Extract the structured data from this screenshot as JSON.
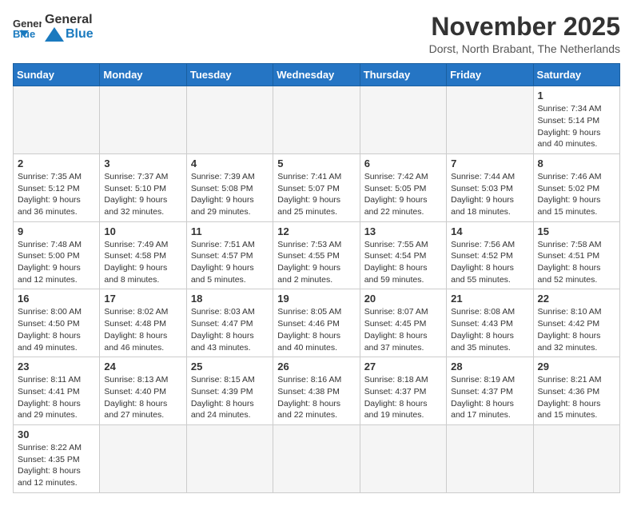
{
  "header": {
    "logo_general": "General",
    "logo_blue": "Blue",
    "month_title": "November 2025",
    "subtitle": "Dorst, North Brabant, The Netherlands"
  },
  "weekdays": [
    "Sunday",
    "Monday",
    "Tuesday",
    "Wednesday",
    "Thursday",
    "Friday",
    "Saturday"
  ],
  "weeks": [
    [
      {
        "day": "",
        "info": ""
      },
      {
        "day": "",
        "info": ""
      },
      {
        "day": "",
        "info": ""
      },
      {
        "day": "",
        "info": ""
      },
      {
        "day": "",
        "info": ""
      },
      {
        "day": "",
        "info": ""
      },
      {
        "day": "1",
        "info": "Sunrise: 7:34 AM\nSunset: 5:14 PM\nDaylight: 9 hours and 40 minutes."
      }
    ],
    [
      {
        "day": "2",
        "info": "Sunrise: 7:35 AM\nSunset: 5:12 PM\nDaylight: 9 hours and 36 minutes."
      },
      {
        "day": "3",
        "info": "Sunrise: 7:37 AM\nSunset: 5:10 PM\nDaylight: 9 hours and 32 minutes."
      },
      {
        "day": "4",
        "info": "Sunrise: 7:39 AM\nSunset: 5:08 PM\nDaylight: 9 hours and 29 minutes."
      },
      {
        "day": "5",
        "info": "Sunrise: 7:41 AM\nSunset: 5:07 PM\nDaylight: 9 hours and 25 minutes."
      },
      {
        "day": "6",
        "info": "Sunrise: 7:42 AM\nSunset: 5:05 PM\nDaylight: 9 hours and 22 minutes."
      },
      {
        "day": "7",
        "info": "Sunrise: 7:44 AM\nSunset: 5:03 PM\nDaylight: 9 hours and 18 minutes."
      },
      {
        "day": "8",
        "info": "Sunrise: 7:46 AM\nSunset: 5:02 PM\nDaylight: 9 hours and 15 minutes."
      }
    ],
    [
      {
        "day": "9",
        "info": "Sunrise: 7:48 AM\nSunset: 5:00 PM\nDaylight: 9 hours and 12 minutes."
      },
      {
        "day": "10",
        "info": "Sunrise: 7:49 AM\nSunset: 4:58 PM\nDaylight: 9 hours and 8 minutes."
      },
      {
        "day": "11",
        "info": "Sunrise: 7:51 AM\nSunset: 4:57 PM\nDaylight: 9 hours and 5 minutes."
      },
      {
        "day": "12",
        "info": "Sunrise: 7:53 AM\nSunset: 4:55 PM\nDaylight: 9 hours and 2 minutes."
      },
      {
        "day": "13",
        "info": "Sunrise: 7:55 AM\nSunset: 4:54 PM\nDaylight: 8 hours and 59 minutes."
      },
      {
        "day": "14",
        "info": "Sunrise: 7:56 AM\nSunset: 4:52 PM\nDaylight: 8 hours and 55 minutes."
      },
      {
        "day": "15",
        "info": "Sunrise: 7:58 AM\nSunset: 4:51 PM\nDaylight: 8 hours and 52 minutes."
      }
    ],
    [
      {
        "day": "16",
        "info": "Sunrise: 8:00 AM\nSunset: 4:50 PM\nDaylight: 8 hours and 49 minutes."
      },
      {
        "day": "17",
        "info": "Sunrise: 8:02 AM\nSunset: 4:48 PM\nDaylight: 8 hours and 46 minutes."
      },
      {
        "day": "18",
        "info": "Sunrise: 8:03 AM\nSunset: 4:47 PM\nDaylight: 8 hours and 43 minutes."
      },
      {
        "day": "19",
        "info": "Sunrise: 8:05 AM\nSunset: 4:46 PM\nDaylight: 8 hours and 40 minutes."
      },
      {
        "day": "20",
        "info": "Sunrise: 8:07 AM\nSunset: 4:45 PM\nDaylight: 8 hours and 37 minutes."
      },
      {
        "day": "21",
        "info": "Sunrise: 8:08 AM\nSunset: 4:43 PM\nDaylight: 8 hours and 35 minutes."
      },
      {
        "day": "22",
        "info": "Sunrise: 8:10 AM\nSunset: 4:42 PM\nDaylight: 8 hours and 32 minutes."
      }
    ],
    [
      {
        "day": "23",
        "info": "Sunrise: 8:11 AM\nSunset: 4:41 PM\nDaylight: 8 hours and 29 minutes."
      },
      {
        "day": "24",
        "info": "Sunrise: 8:13 AM\nSunset: 4:40 PM\nDaylight: 8 hours and 27 minutes."
      },
      {
        "day": "25",
        "info": "Sunrise: 8:15 AM\nSunset: 4:39 PM\nDaylight: 8 hours and 24 minutes."
      },
      {
        "day": "26",
        "info": "Sunrise: 8:16 AM\nSunset: 4:38 PM\nDaylight: 8 hours and 22 minutes."
      },
      {
        "day": "27",
        "info": "Sunrise: 8:18 AM\nSunset: 4:37 PM\nDaylight: 8 hours and 19 minutes."
      },
      {
        "day": "28",
        "info": "Sunrise: 8:19 AM\nSunset: 4:37 PM\nDaylight: 8 hours and 17 minutes."
      },
      {
        "day": "29",
        "info": "Sunrise: 8:21 AM\nSunset: 4:36 PM\nDaylight: 8 hours and 15 minutes."
      }
    ],
    [
      {
        "day": "30",
        "info": "Sunrise: 8:22 AM\nSunset: 4:35 PM\nDaylight: 8 hours and 12 minutes."
      },
      {
        "day": "",
        "info": ""
      },
      {
        "day": "",
        "info": ""
      },
      {
        "day": "",
        "info": ""
      },
      {
        "day": "",
        "info": ""
      },
      {
        "day": "",
        "info": ""
      },
      {
        "day": "",
        "info": ""
      }
    ]
  ]
}
